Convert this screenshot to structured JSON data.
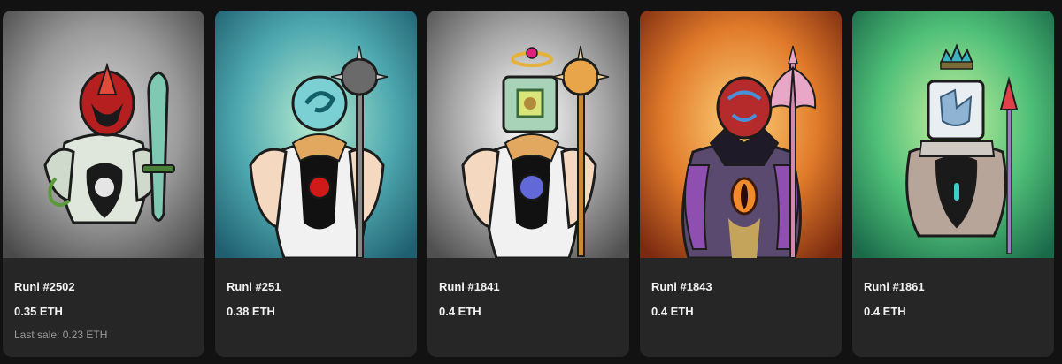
{
  "cards": [
    {
      "name": "Runi #2502",
      "price": "0.35 ETH",
      "last_sale": "Last sale: 0.23 ETH",
      "bg": "#8c8c8c"
    },
    {
      "name": "Runi #251",
      "price": "0.38 ETH",
      "last_sale": "",
      "bg": "#5fb6b1"
    },
    {
      "name": "Runi #1841",
      "price": "0.4 ETH",
      "last_sale": "",
      "bg": "#9a9a9a"
    },
    {
      "name": "Runi #1843",
      "price": "0.4 ETH",
      "last_sale": "",
      "bg": "#e07a2a"
    },
    {
      "name": "Runi #1861",
      "price": "0.4 ETH",
      "last_sale": "",
      "bg": "#5fc37a"
    }
  ]
}
